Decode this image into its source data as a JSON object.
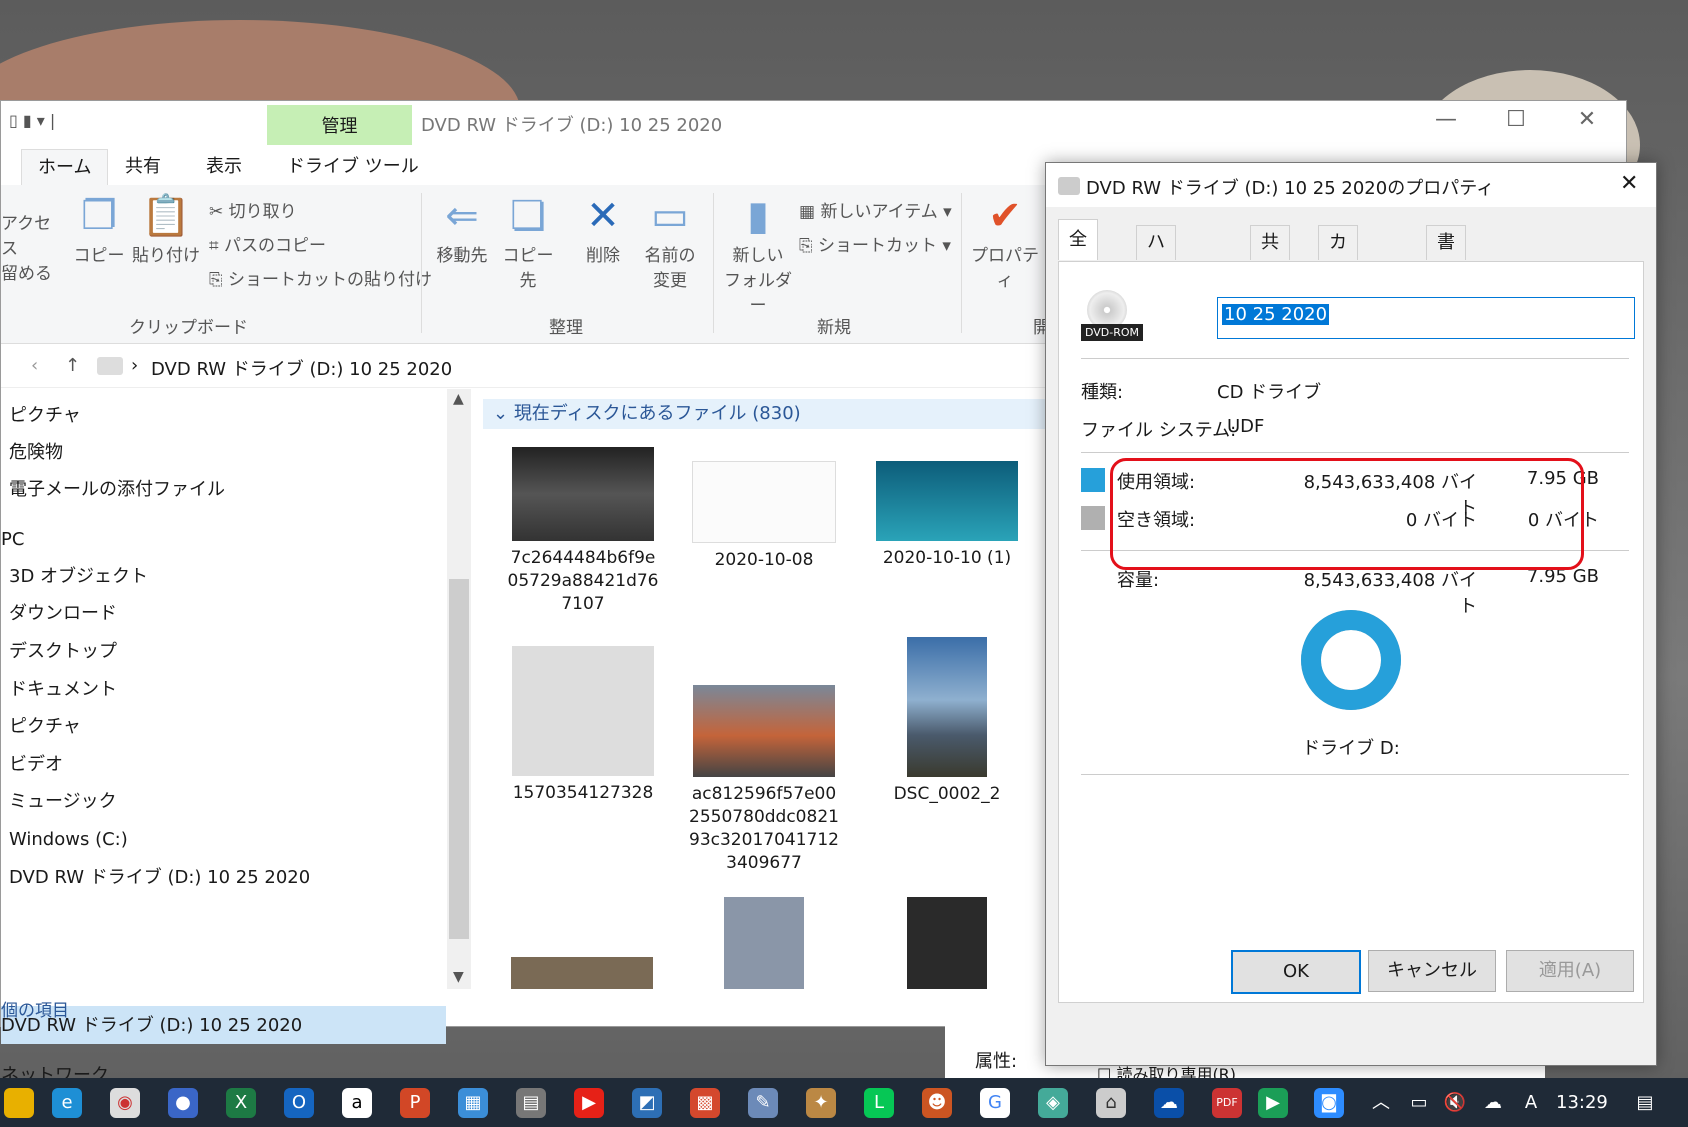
{
  "explorer": {
    "title": "DVD RW ドライブ (D:) 10 25 2020",
    "context_tab": "管理",
    "tabs": [
      "ホーム",
      "共有",
      "表示",
      "ドライブ ツール"
    ],
    "ribbon": {
      "access_line1": "アクセス",
      "access_line2": "留める",
      "copy": "コピー",
      "paste": "貼り付け",
      "cut": "切り取り",
      "copy_path": "パスのコピー",
      "paste_shortcut": "ショートカットの貼り付け",
      "clipboard_group": "クリップボード",
      "move_to": "移動先",
      "copy_to": "コピー先",
      "delete": "削除",
      "rename_line1": "名前の",
      "rename_line2": "変更",
      "organize_group": "整理",
      "new_folder_line1": "新しい",
      "new_folder_line2": "フォルダー",
      "new_item": "新しいアイテム",
      "shortcut": "ショートカット",
      "new_group": "新規",
      "properties": "プロパティ",
      "open_group": "開"
    },
    "address": "DVD RW ドライブ (D:) 10 25 2020",
    "nav_items": [
      "ピクチャ",
      "危険物",
      "電子メールの添付ファイル",
      "PC",
      "3D オブジェクト",
      "ダウンロード",
      "デスクトップ",
      "ドキュメント",
      "ピクチャ",
      "ビデオ",
      "ミュージック",
      "Windows (C:)",
      "DVD RW ドライブ (D:) 10 25 2020",
      "DVD RW ドライブ (D:) 10 25 2020",
      "ネットワーク"
    ],
    "status_text": "個の項目",
    "group_header": "現在ディスクにあるファイル (830)",
    "files": [
      {
        "name": "7c2644484b6f9e\n05729a88421d76\n7107"
      },
      {
        "name": "2020-10-08"
      },
      {
        "name": "2020-10-10 (1)"
      },
      {
        "name": "1570354127328"
      },
      {
        "name": "ac812596f57e00\n2550780ddc0821\n93c32017041712\n3409677"
      },
      {
        "name": "DSC_0002_2"
      }
    ]
  },
  "properties": {
    "title": "DVD RW ドライブ (D:) 10 25 2020のプロパティ",
    "tabs": [
      "全般",
      "ハードウェア",
      "共有",
      "カスタマイズ",
      "書き込み"
    ],
    "icon_label": "DVD-ROM",
    "label_value": "10 25 2020",
    "type_label": "種類:",
    "type_value": "CD ドライブ",
    "fs_label": "ファイル システム:",
    "fs_value": "UDF",
    "used_label": "使用領域:",
    "used_bytes": "8,543,633,408 バイト",
    "used_gb": "7.95 GB",
    "free_label": "空き領域:",
    "free_bytes": "0 バイト",
    "free_gb": "0 バイト",
    "capacity_label": "容量:",
    "capacity_bytes": "8,543,633,408 バイト",
    "capacity_gb": "7.95 GB",
    "drive_label": "ドライブ D:",
    "used_fraction": 1.0,
    "attr_label": "属性:",
    "readonly_label": "読み取り専用(R)",
    "ok": "OK",
    "cancel": "キャンセル",
    "apply": "適用(A)",
    "used_color": "#26a0da",
    "free_color": "#b0b0b0"
  },
  "taskbar": {
    "time": "13:29",
    "ime": "A"
  }
}
